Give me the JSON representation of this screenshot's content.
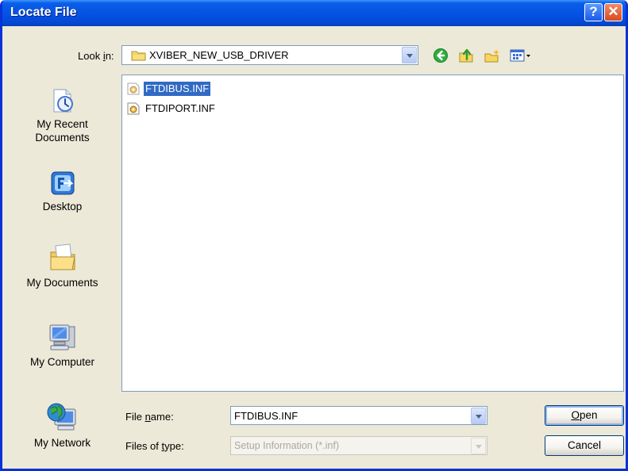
{
  "window": {
    "title": "Locate File",
    "help_label": "?",
    "close_label": "✕"
  },
  "lookin": {
    "label_pre": "Look ",
    "label_mnemonic": "i",
    "label_post": "n:",
    "value": "XVIBER_NEW_USB_DRIVER"
  },
  "toolbar": {
    "icons": [
      "back-icon",
      "up-folder-icon",
      "new-folder-icon",
      "views-menu-icon"
    ]
  },
  "places": [
    {
      "label": "My Recent Documents",
      "icon": "recent-documents-icon"
    },
    {
      "label": "Desktop",
      "icon": "desktop-icon"
    },
    {
      "label": "My Documents",
      "icon": "my-documents-icon"
    },
    {
      "label": "My Computer",
      "icon": "my-computer-icon"
    },
    {
      "label": "My Network",
      "icon": "my-network-icon"
    }
  ],
  "files": [
    {
      "name": "FTDIBUS.INF",
      "selected": true
    },
    {
      "name": "FTDIPORT.INF",
      "selected": false
    }
  ],
  "filename": {
    "label_pre": "File ",
    "label_mnemonic": "n",
    "label_post": "ame:",
    "value": "FTDIBUS.INF"
  },
  "filetype": {
    "label_pre": "Files of ",
    "label_mnemonic": "t",
    "label_post": "ype:",
    "value": "Setup Information (*.inf)"
  },
  "buttons": {
    "open_mnemonic": "O",
    "open_rest": "pen",
    "cancel": "Cancel"
  },
  "colors": {
    "titlebar": "#0553e3",
    "face": "#ece9d8",
    "selection": "#316ac5"
  }
}
